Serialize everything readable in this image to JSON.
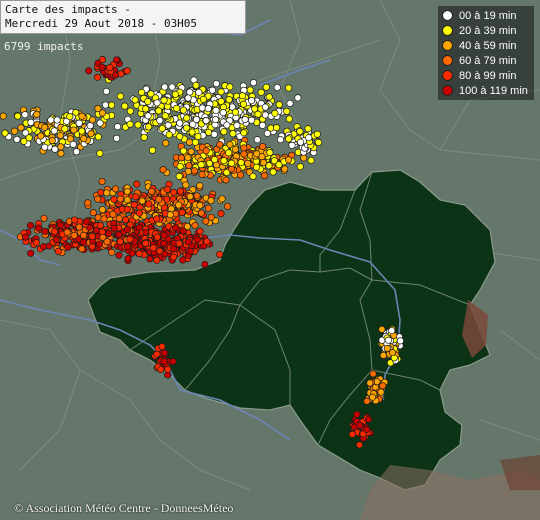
{
  "title": {
    "line1": "Carte des impacts -",
    "line2": "Mercredi 29 Aout 2018 - 03H05"
  },
  "impact_count": "6799 impacts",
  "credit": "© Association Météo Centre - DonneesMéteo",
  "legend": [
    {
      "label": "00 à 19 min",
      "color": "#ffffff"
    },
    {
      "label": "20 à 39 min",
      "color": "#ffff00"
    },
    {
      "label": "40 à 59 min",
      "color": "#ffa500"
    },
    {
      "label": "60 à 79 min",
      "color": "#ff6a00"
    },
    {
      "label": "80 à 99 min",
      "color": "#ff2a00"
    },
    {
      "label": "100 à 119 min",
      "color": "#c80000"
    }
  ],
  "colors": {
    "land": "#65766b",
    "region": "#0d3316",
    "border": "#6d8070",
    "river": "#6b86b5",
    "relief": "#7a4a3a"
  }
}
